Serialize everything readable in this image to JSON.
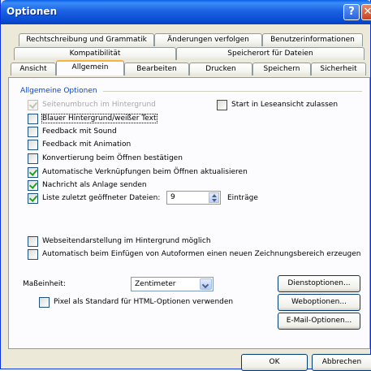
{
  "window": {
    "title": "Optionen",
    "help_glyph": "?",
    "close_glyph": "✕"
  },
  "tabs": {
    "row1": [
      "Rechtschreibung und Grammatik",
      "Änderungen verfolgen",
      "Benutzerinformationen"
    ],
    "row2": [
      "Kompatibilität",
      "Speicherort für Dateien"
    ],
    "row3": [
      "Ansicht",
      "Allgemein",
      "Bearbeiten",
      "Drucken",
      "Speichern",
      "Sicherheit"
    ],
    "active": "Allgemein"
  },
  "general": {
    "group_label": "Allgemeine Optionen",
    "options": [
      {
        "label": "Seitenumbruch im Hintergrund",
        "checked": true,
        "disabled": true
      },
      {
        "label": "Start in Leseansicht zulassen",
        "checked": false,
        "disabled": false
      },
      {
        "label": "Blauer Hintergrund/weißer Text",
        "checked": false,
        "disabled": false
      },
      {
        "label": "Feedback mit Sound",
        "checked": false,
        "disabled": false
      },
      {
        "label": "Feedback mit Animation",
        "checked": false,
        "disabled": false
      },
      {
        "label": "Konvertierung beim Öffnen bestätigen",
        "checked": false,
        "disabled": false
      },
      {
        "label": "Automatische Verknüpfungen beim Öffnen aktualisieren",
        "checked": true,
        "disabled": false
      },
      {
        "label": "Nachricht als Anlage senden",
        "checked": true,
        "disabled": false
      },
      {
        "label": "Liste zuletzt geöffneter Dateien:",
        "checked": true,
        "disabled": false
      },
      {
        "label": "Webseitendarstellung im Hintergrund möglich",
        "checked": false,
        "disabled": false
      },
      {
        "label": "Automatisch beim Einfügen von Autoformen einen neuen Zeichnungsbereich erzeugen",
        "checked": false,
        "disabled": false
      },
      {
        "label": "Pixel als Standard für HTML-Optionen verwenden",
        "checked": false,
        "disabled": false
      }
    ],
    "recent_files_value": "9",
    "recent_files_unit": "Einträge"
  },
  "units": {
    "label": "Maßeinheit:",
    "value": "Zentimeter"
  },
  "buttons": {
    "service_options": "Dienstoptionen...",
    "web_options": "Weboptionen...",
    "email_options": "E-Mail-Optionen...",
    "ok": "OK",
    "cancel": "Abbrechen"
  }
}
